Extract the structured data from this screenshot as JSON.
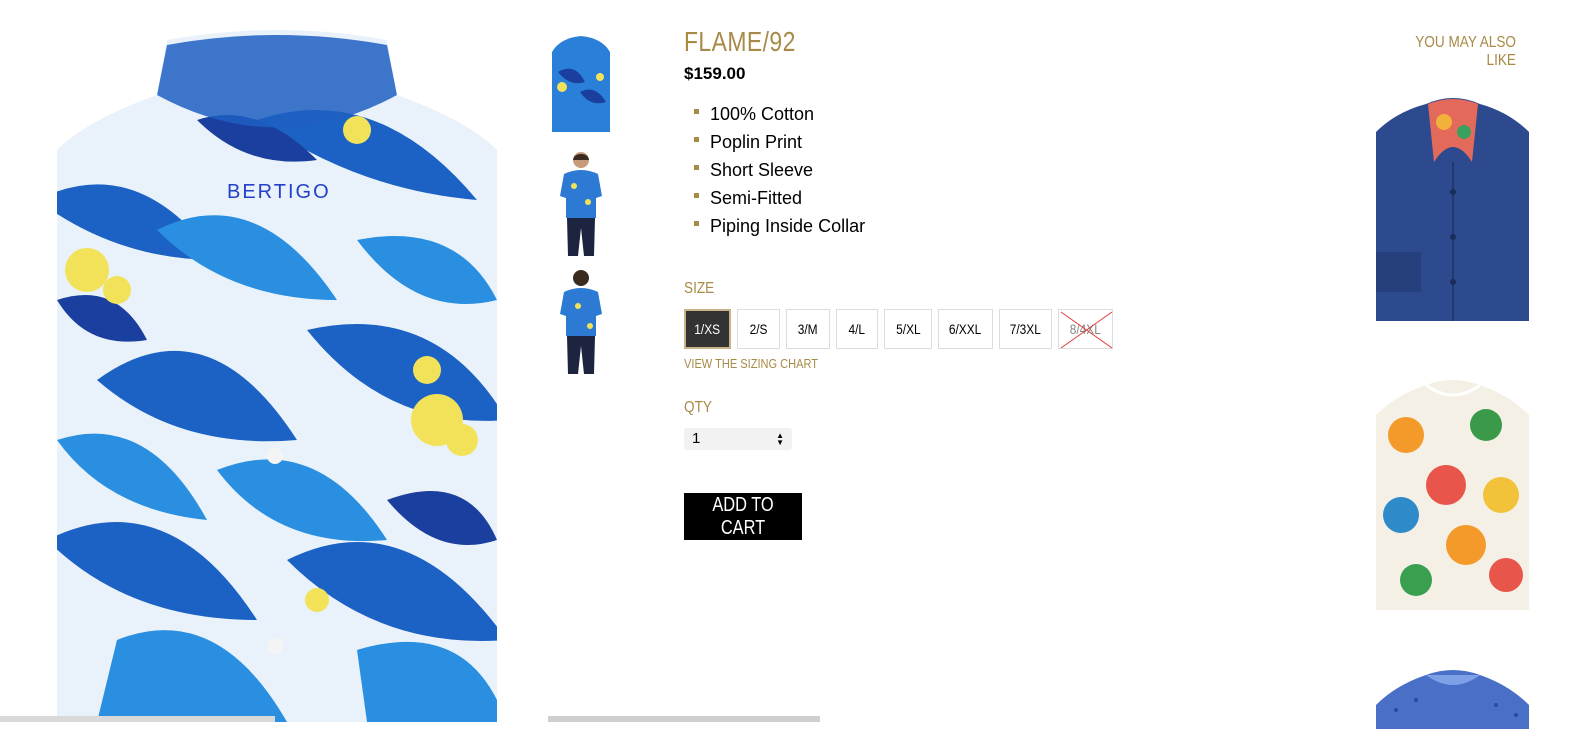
{
  "colors": {
    "gold": "#a88a47",
    "button": "#000000"
  },
  "product": {
    "title": "FLAME/92",
    "price": "$159.00",
    "features": [
      "100% Cotton",
      "Poplin Print",
      "Short Sleeve",
      "Semi-Fitted",
      "Piping Inside Collar"
    ],
    "brand_logo": "BERTIGO"
  },
  "size": {
    "label": "SIZE",
    "options": [
      {
        "label": "1/XS",
        "state": "selected"
      },
      {
        "label": "2/S",
        "state": "available"
      },
      {
        "label": "3/M",
        "state": "available"
      },
      {
        "label": "4/L",
        "state": "available"
      },
      {
        "label": "5/XL",
        "state": "available"
      },
      {
        "label": "6/XXL",
        "state": "available"
      },
      {
        "label": "7/3XL",
        "state": "available"
      },
      {
        "label": "8/4XL",
        "state": "unavailable"
      }
    ],
    "chart_link": "VIEW THE SIZING CHART"
  },
  "qty": {
    "label": "QTY",
    "value": "1"
  },
  "cart": {
    "label": "ADD TO CART"
  },
  "related": {
    "title": "YOU MAY ALSO LIKE"
  },
  "icons": [
    "select-arrows-icon",
    "unavailable-cross-icon"
  ]
}
